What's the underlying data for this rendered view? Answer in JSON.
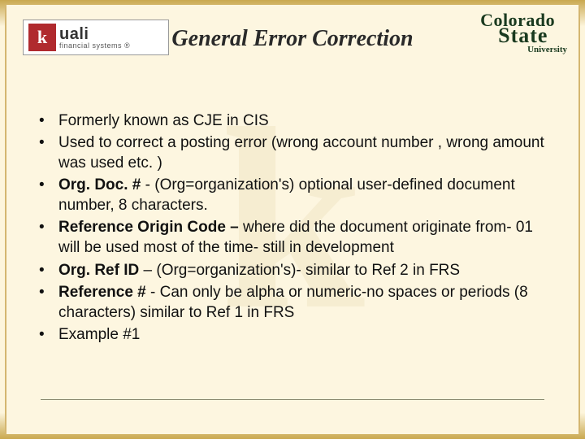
{
  "logo_left": {
    "glyph": "k",
    "brand": "uali",
    "sub": "financial systems ®"
  },
  "title": "General Error Correction",
  "logo_right": {
    "line1": "Colorado",
    "line2": "State",
    "line3": "University"
  },
  "bullets": [
    {
      "bold": "",
      "rest": "Formerly known as CJE in CIS"
    },
    {
      "bold": "",
      "rest": "Used to correct a posting error (wrong account number , wrong amount was used etc. )"
    },
    {
      "bold": "Org. Doc. # ",
      "rest": "- (Org=organization's) optional user-defined document number, 8 characters."
    },
    {
      "bold": "Reference Origin Code – ",
      "rest": "where did the document originate from- 01 will be used most of the time- still in development"
    },
    {
      "bold": "Org. Ref ID ",
      "rest": "– (Org=organization's)- similar to Ref 2 in FRS"
    },
    {
      "bold": "Reference # ",
      "rest": "- Can only be alpha or numeric-no spaces or periods (8 characters) similar to Ref 1 in FRS"
    },
    {
      "bold": "",
      "rest": "Example #1"
    }
  ]
}
